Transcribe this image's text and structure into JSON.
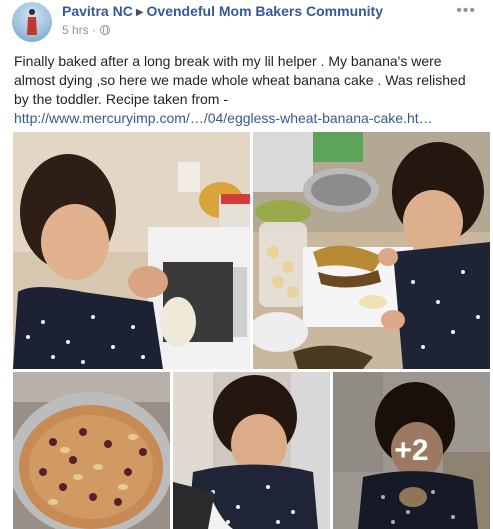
{
  "post": {
    "author": "Pavitra NC",
    "group": "Ovendeful Mom Bakers Community",
    "timestamp": "5 hrs",
    "privacy_icon": "globe-icon",
    "more_icon": "ellipsis-icon",
    "text": "Finally baked after a long break with my lil helper . My banana's were almost dying ,so here we made whole wheat banana cake . Was relished by the toddler. Recipe taken from - ",
    "link_text": "http://www.mercuryimp.com/…/04/eggless-wheat-banana-cake.ht…"
  },
  "photos": {
    "more_count": "+2",
    "items": [
      {
        "name": "photo-child-mashing-banana"
      },
      {
        "name": "photo-child-with-bananas"
      },
      {
        "name": "photo-baked-cake"
      },
      {
        "name": "photo-child-stirring"
      },
      {
        "name": "photo-child-more"
      }
    ]
  }
}
